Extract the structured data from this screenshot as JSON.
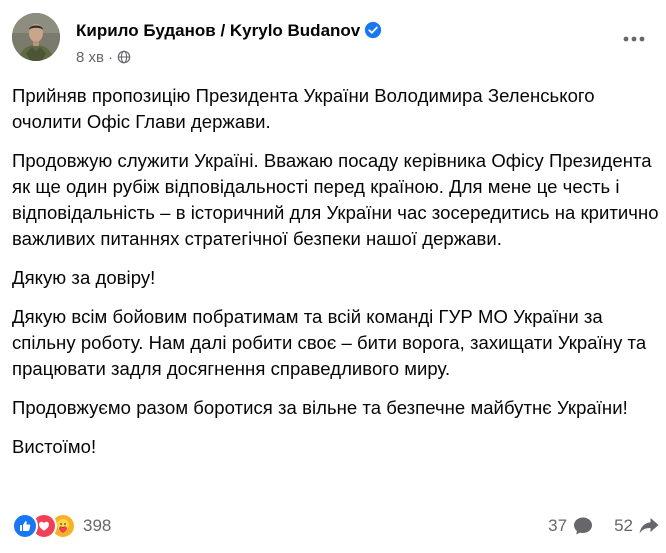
{
  "post": {
    "author": "Кирило Буданов / Kyrylo Budanov",
    "time": "8 хв",
    "separator": "·",
    "paragraphs": [
      "Прийняв пропозицію Президента України Володимира Зеленського очолити Офіс Глави держави.",
      "Продовжую служити Україні. Вважаю посаду керівника Офісу Президента як ще один рубіж відповідальності перед країною. Для мене це честь і відповідальність – в історичний для України час зосередитись на критично важливих питаннях стратегічної безпеки нашої держави.",
      "Дякую за довіру!",
      "Дякую всім бойовим побратимам та всій команді ГУР МО України за спільну роботу. Нам далі робити своє – бити ворога, захищати Україну та працювати задля досягнення справедливого миру.",
      "Продовжуємо разом боротися за вільне та безпечне майбутнє України!",
      "Вистоїмо!"
    ]
  },
  "footer": {
    "reaction_count": "398",
    "comment_count": "37",
    "share_count": "52"
  },
  "icons": {
    "verified": "verified-badge-icon",
    "globe": "globe-icon",
    "more": "more-options-icon",
    "like": "like-reaction-icon",
    "love": "love-reaction-icon",
    "care": "care-reaction-icon",
    "comment": "comment-icon",
    "share": "share-icon"
  },
  "colors": {
    "brand_blue": "#1877f2",
    "love_red": "#f33e58",
    "care_yellow": "#f7b125",
    "secondary_text": "#65676b"
  }
}
